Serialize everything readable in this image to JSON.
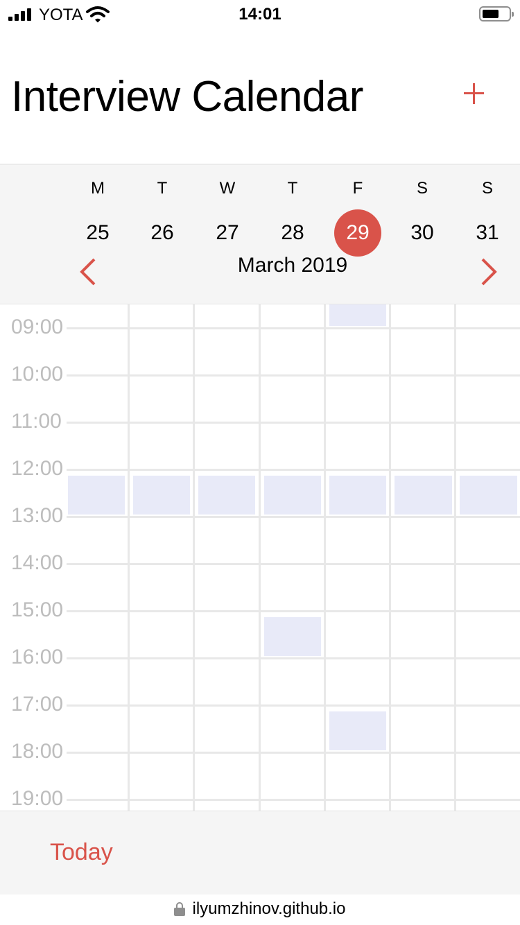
{
  "status_bar": {
    "carrier": "YOTA",
    "time": "14:01",
    "battery_level": 0.6
  },
  "header": {
    "title": "Interview Calendar",
    "add_icon": "plus-icon"
  },
  "week": {
    "days": [
      {
        "letter": "M",
        "date": "25"
      },
      {
        "letter": "T",
        "date": "26"
      },
      {
        "letter": "W",
        "date": "27"
      },
      {
        "letter": "T",
        "date": "28"
      },
      {
        "letter": "F",
        "date": "29"
      },
      {
        "letter": "S",
        "date": "30"
      },
      {
        "letter": "S",
        "date": "31"
      }
    ],
    "selected_date": "29",
    "month_label": "March 2019",
    "prev_icon": "chevron-left-icon",
    "next_icon": "chevron-right-icon"
  },
  "schedule": {
    "hours": [
      "09:00",
      "10:00",
      "11:00",
      "12:00",
      "13:00",
      "14:00",
      "15:00",
      "16:00",
      "17:00",
      "18:00",
      "19:00"
    ],
    "events": [
      {
        "day": 4,
        "hour": "08:00"
      },
      {
        "day": 0,
        "hour": "12:00"
      },
      {
        "day": 1,
        "hour": "12:00"
      },
      {
        "day": 2,
        "hour": "12:00"
      },
      {
        "day": 3,
        "hour": "12:00"
      },
      {
        "day": 4,
        "hour": "12:00"
      },
      {
        "day": 5,
        "hour": "12:00"
      },
      {
        "day": 6,
        "hour": "12:00"
      },
      {
        "day": 3,
        "hour": "15:00"
      },
      {
        "day": 4,
        "hour": "17:00"
      }
    ],
    "event_color": "#e8eaf8"
  },
  "footer": {
    "today_label": "Today",
    "url": "ilyumzhinov.github.io"
  },
  "colors": {
    "accent": "#d9534a",
    "grid_line": "#e8e8e8",
    "time_text": "#bdbdbd"
  }
}
